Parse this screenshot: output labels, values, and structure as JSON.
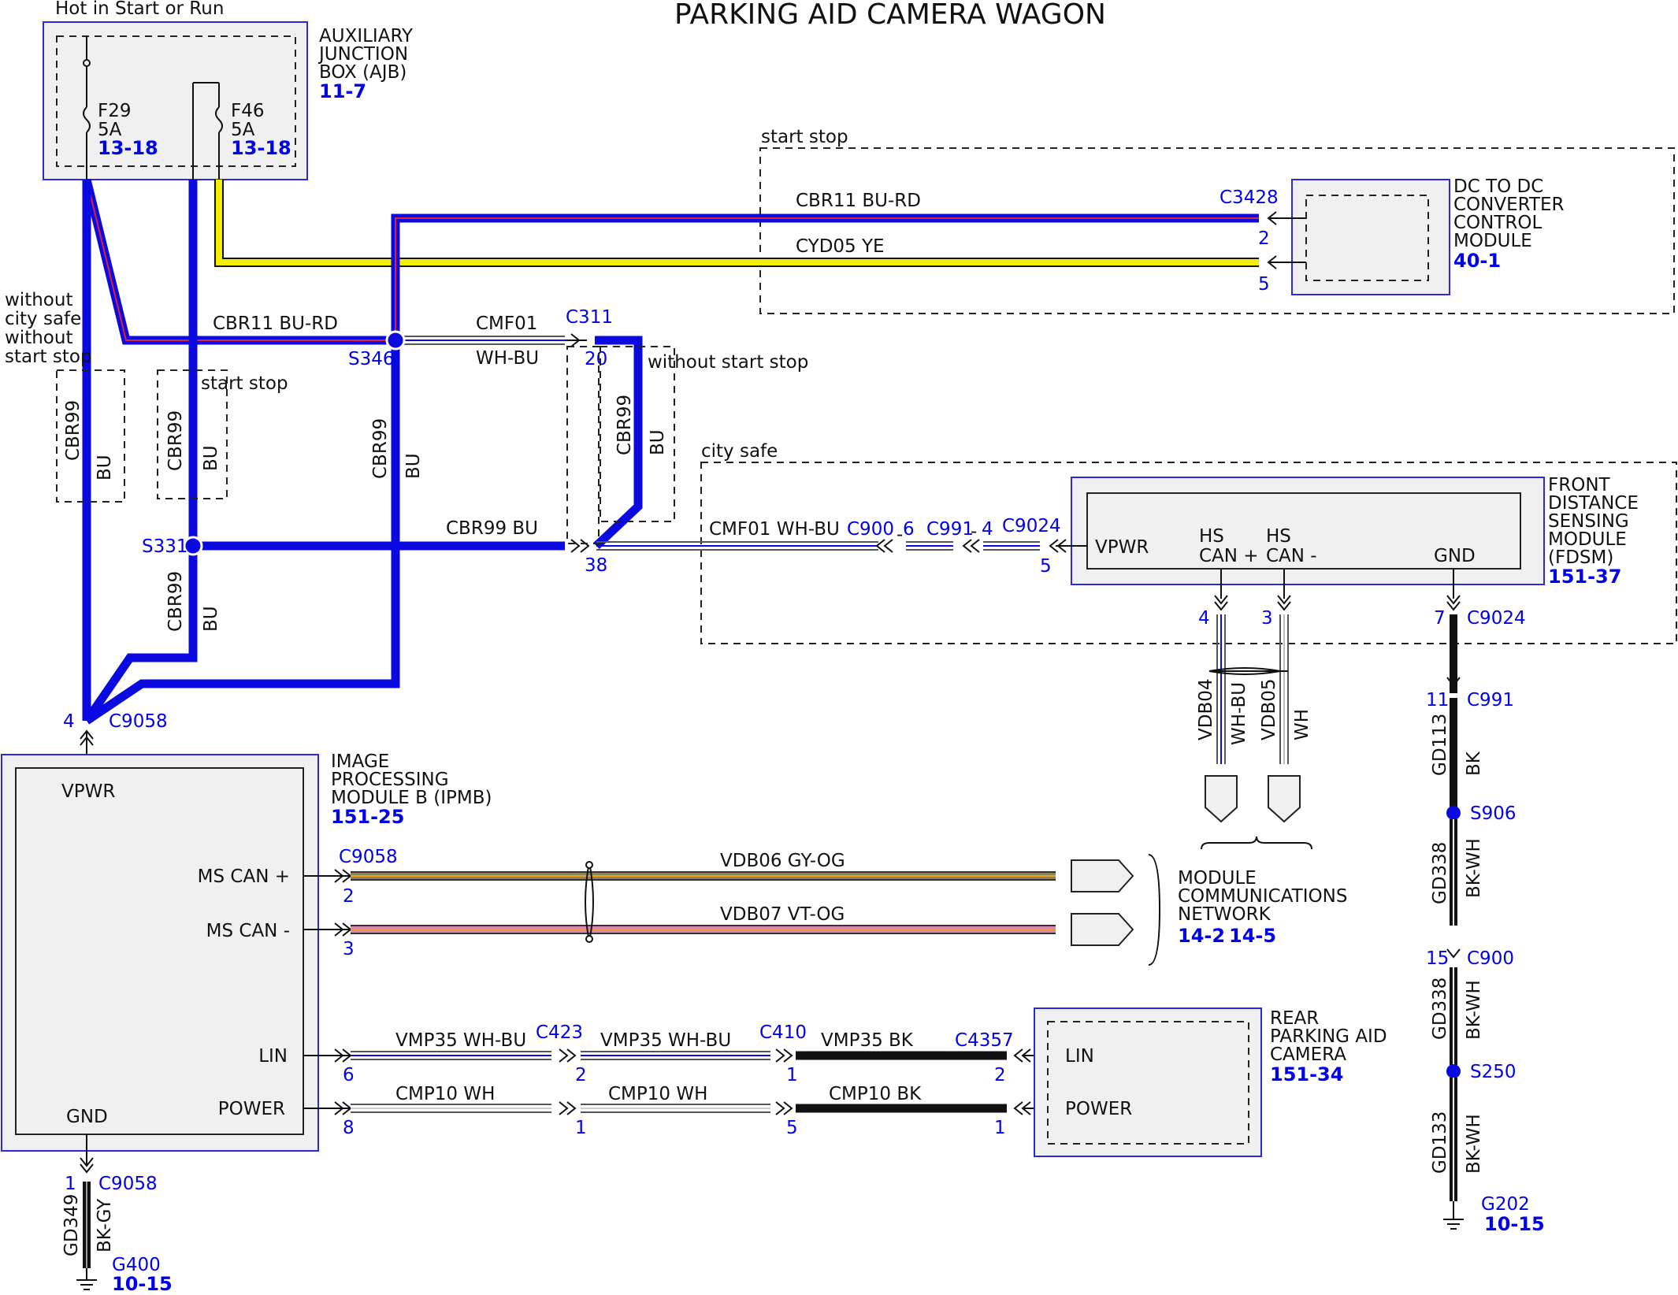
{
  "title": "PARKING AID CAMERA WAGON",
  "ajb": {
    "supply_label": "Hot in Start or Run",
    "name_lines": [
      "AUXILIARY",
      "JUNCTION",
      "BOX (AJB)"
    ],
    "ref": "11-7",
    "fuses": [
      {
        "name": "F29",
        "rating": "5A",
        "ref": "13-18"
      },
      {
        "name": "F46",
        "rating": "5A",
        "ref": "13-18"
      }
    ]
  },
  "dcdc": {
    "group_label": "start stop",
    "name_lines": [
      "DC TO DC",
      "CONVERTER",
      "CONTROL",
      "MODULE"
    ],
    "ref": "40-1",
    "connector": "C3428",
    "pins": [
      "2",
      "5"
    ]
  },
  "wires": {
    "cbr11_top": "CBR11  BU-RD",
    "cyd05": "CYD05  YE",
    "cbr11_left": "CBR11  BU-RD",
    "cmf01_a": "CMF01",
    "cmf01_b": "WH-BU",
    "cbr99_bu": "CBR99  BU",
    "cmf01_fdsm": "CMF01  WH-BU",
    "cbr99": "CBR99",
    "bu": "BU"
  },
  "splices": {
    "s346": "S346",
    "s331": "S331",
    "s906": "S906",
    "s250": "S250"
  },
  "options": {
    "without_city_safe": [
      "without",
      "city safe",
      "without",
      "start stop"
    ],
    "start_stop": "start stop",
    "without_start_stop": "without start stop",
    "city_safe": "city safe"
  },
  "c311": {
    "name": "C311",
    "pin_top": "20",
    "pin_bottom": "38"
  },
  "fdsm": {
    "name_lines": [
      "FRONT",
      "DISTANCE",
      "SENSING",
      "MODULE",
      "(FDSM)"
    ],
    "ref": "151-37",
    "vpwr": "VPWR",
    "hs_can_plus": [
      "HS",
      "CAN +"
    ],
    "hs_can_minus": [
      "HS",
      "CAN -"
    ],
    "gnd": "GND",
    "connectors": {
      "c900": "C900",
      "c900_pin": "6",
      "c991": "C991",
      "c991_pin": "4",
      "c9024": "C9024",
      "c9024_pin": "5"
    },
    "can_pins": {
      "plus": "4",
      "minus": "3"
    },
    "gnd_pin": "7",
    "gnd_conn": "C9024"
  },
  "can_wires": {
    "vdb04": "VDB04",
    "vdb04_color": "WH-BU",
    "vdb05": "VDB05",
    "vdb05_color": "WH"
  },
  "ground_right": {
    "c991_pin": "11",
    "c991": "C991",
    "gd113": "GD113",
    "gd113_color": "BK",
    "gd338": "GD338",
    "gd338_color": "BK-WH",
    "c900_pin": "15",
    "c900": "C900",
    "gd338b": "GD338",
    "gd338b_color": "BK-WH",
    "gd133": "GD133",
    "gd133_color": "BK-WH",
    "g202": "G202",
    "g202_ref": "10-15"
  },
  "ipmb": {
    "c9058_pin": "4",
    "c9058": "C9058",
    "name_lines": [
      "IMAGE",
      "PROCESSING",
      "MODULE B (IPMB)"
    ],
    "ref": "151-25",
    "vpwr": "VPWR",
    "ms_can_plus": "MS CAN +",
    "ms_can_minus": "MS CAN -",
    "lin": "LIN",
    "power": "POWER",
    "gnd": "GND",
    "conn_right": "C9058",
    "pins": {
      "ms_plus": "2",
      "ms_minus": "3",
      "lin": "6",
      "power": "8"
    }
  },
  "ms_can": {
    "vdb06": "VDB06   GY-OG",
    "vdb07": "VDB07   VT-OG",
    "network_lines": [
      "MODULE",
      "COMMUNICATIONS",
      "NETWORK"
    ],
    "refs": [
      "14-2",
      "14-5"
    ]
  },
  "camera_run": {
    "vmp35_a": "VMP35   WH-BU",
    "c423": "C423",
    "vmp35_b": "VMP35   WH-BU",
    "c410": "C410",
    "vmp35_c": "VMP35   BK",
    "c4357": "C4357",
    "cmp10_a": "CMP10   WH",
    "cmp10_b": "CMP10   WH",
    "cmp10_c": "CMP10  BK",
    "pins_lin": [
      "2",
      "1",
      "2"
    ],
    "pins_pwr": [
      "1",
      "5",
      "1"
    ]
  },
  "camera": {
    "name_lines": [
      "REAR",
      "PARKING AID",
      "CAMERA"
    ],
    "ref": "151-34",
    "lin": "LIN",
    "power": "POWER"
  },
  "ground_left": {
    "pin": "1",
    "conn": "C9058",
    "gd349": "GD349",
    "gd349_color": "BK-GY",
    "g400": "G400",
    "g400_ref": "10-15"
  },
  "colors": {
    "blue": "#0a0ae0",
    "red": "#e0203a",
    "yellow": "#f5f000",
    "gyog": "#8c8455",
    "vtog": "#e084b0",
    "link_blue": "#0000ee"
  }
}
